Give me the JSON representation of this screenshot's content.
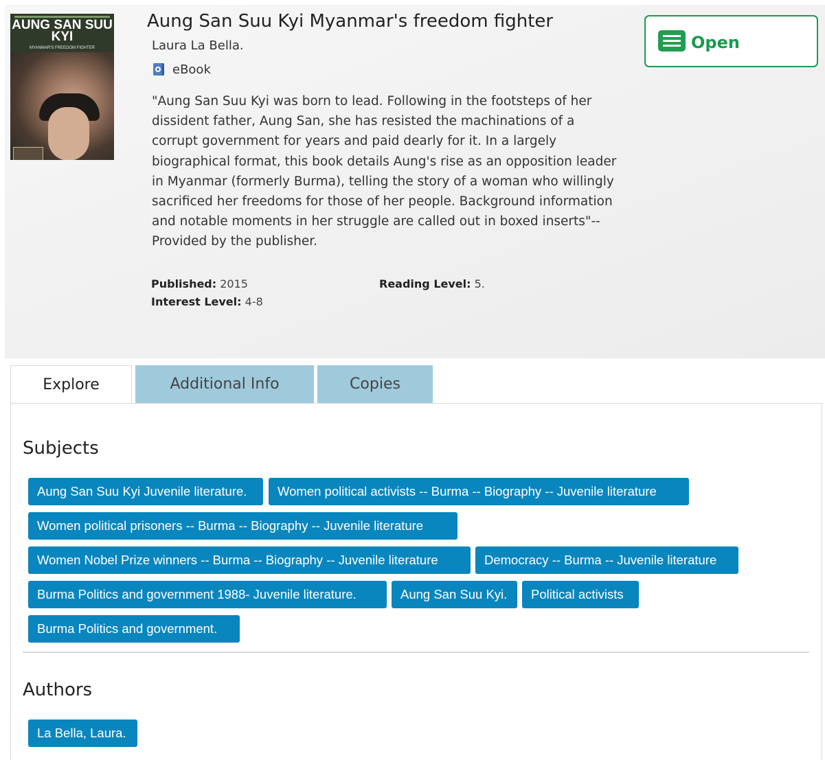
{
  "book": {
    "cover": {
      "title": "AUNG SAN SUU KYI",
      "subtitle": "MYANMAR'S FREEDOM FIGHTER"
    },
    "title": "Aung San Suu Kyi Myanmar's freedom fighter",
    "author": "Laura La Bella.",
    "format": {
      "icon": "ebook-icon",
      "label": "eBook"
    },
    "description": "\"Aung San Suu Kyi was born to lead. Following in the footsteps of her dissident father, Aung San, she has resisted the machinations of a corrupt government for years and paid dearly for it. In a largely biographical format, this book details Aung's rise as an opposition leader in Myanmar (formerly Burma), telling the story of a woman who willingly sacrificed her freedoms for those of her people. Background information and notable moments in her struggle are called out in boxed inserts\"--Provided by the publisher.",
    "published": {
      "label": "Published:",
      "value": "2015"
    },
    "reading_level": {
      "label": "Reading Level:",
      "value": "5."
    },
    "interest_level": {
      "label": "Interest Level:",
      "value": "4-8"
    }
  },
  "actions": {
    "open": {
      "label": "Open",
      "icon": "open-book-icon",
      "color": "#1b9a4e"
    }
  },
  "tabs": [
    {
      "label": "Explore",
      "active": true
    },
    {
      "label": "Additional Info",
      "active": false
    },
    {
      "label": "Copies",
      "active": false
    }
  ],
  "explore": {
    "subjects_title": "Subjects",
    "subjects": [
      "Aung San Suu Kyi Juvenile literature.",
      "Women political activists -- Burma -- Biography -- Juvenile literature",
      "Women political prisoners -- Burma -- Biography -- Juvenile literature",
      "Women Nobel Prize winners -- Burma -- Biography -- Juvenile literature",
      "Democracy -- Burma -- Juvenile literature",
      "Burma Politics and government 1988- Juvenile literature.",
      "Aung San Suu Kyi.",
      "Political activists",
      "Burma Politics and government."
    ],
    "authors_title": "Authors",
    "authors": [
      "La Bella, Laura."
    ]
  },
  "colors": {
    "tag_bg": "#0a86be",
    "tab_inactive_bg": "#9fcadb",
    "accent_green": "#1b9a4e"
  }
}
